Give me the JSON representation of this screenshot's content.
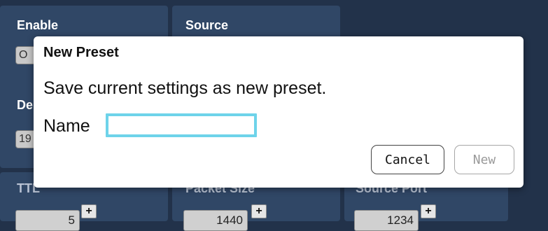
{
  "background": {
    "labels": {
      "enable": "Enable",
      "source": "Source",
      "destination_partial": "De",
      "ttl": "TTL",
      "packet_size": "Packet Size",
      "source_port": "Source Port"
    },
    "enable_value_partial": "O",
    "destination_value_partial": "19",
    "ttl_value": "5",
    "packet_size_value": "1440",
    "source_port_value": "1234",
    "plus": "+"
  },
  "dialog": {
    "title": "New Preset",
    "message": "Save current settings as new preset.",
    "name_label": "Name",
    "name_value": "",
    "cancel_label": "Cancel",
    "new_label": "New"
  },
  "colors": {
    "page_bg": "#22324a",
    "panel_bg": "#304766",
    "input_focus_border": "#6ed3ea"
  }
}
